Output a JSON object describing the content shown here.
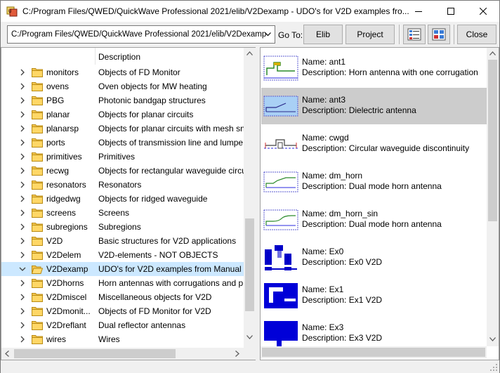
{
  "window": {
    "title": "C:/Program Files/QWED/QuickWave Professional 2021/elib/V2Dexamp - UDO's for V2D examples fro..."
  },
  "toolbar": {
    "path_value": "C:/Program Files/QWED/QuickWave Professional 2021/elib/V2Dexamp",
    "goto_label": "Go To:",
    "elib_label": "Elib",
    "project_label": "Project",
    "close_label": "Close"
  },
  "tree": {
    "header_description": "Description",
    "rows": [
      {
        "name": "monitors",
        "desc": "Objects of FD Monitor"
      },
      {
        "name": "ovens",
        "desc": "Oven objects for MW heating"
      },
      {
        "name": "PBG",
        "desc": "Photonic bandgap structures"
      },
      {
        "name": "planar",
        "desc": "Objects for planar circuits"
      },
      {
        "name": "planarsp",
        "desc": "Objects for planar circuits with mesh sn"
      },
      {
        "name": "ports",
        "desc": "Objects of transmission line and lumpe"
      },
      {
        "name": "primitives",
        "desc": "Primitives"
      },
      {
        "name": "recwg",
        "desc": "Objects for rectangular waveguide circu"
      },
      {
        "name": "resonators",
        "desc": "Resonators"
      },
      {
        "name": "ridgedwg",
        "desc": "Objects for ridged waveguide"
      },
      {
        "name": "screens",
        "desc": "Screens"
      },
      {
        "name": "subregions",
        "desc": "Subregions"
      },
      {
        "name": "V2D",
        "desc": "Basic structures for V2D applications"
      },
      {
        "name": "V2Delem",
        "desc": "V2D-elements - NOT OBJECTS"
      },
      {
        "name": "V2Dexamp",
        "desc": "UDO's for V2D examples from Manual"
      },
      {
        "name": "V2Dhorns",
        "desc": "Horn antennas with corrugations and p"
      },
      {
        "name": "V2Dmiscel",
        "desc": "Miscellaneous objects for V2D"
      },
      {
        "name": "V2Dmonit...",
        "desc": "Objects of FD Monitor for V2D"
      },
      {
        "name": "V2Dreflant",
        "desc": "Dual reflector antennas"
      },
      {
        "name": "wires",
        "desc": "Wires"
      }
    ]
  },
  "udo_list": {
    "items": [
      {
        "name": "Name: ant1",
        "desc": "Description: Horn antenna with one corrugation"
      },
      {
        "name": "Name: ant3",
        "desc": "Description: Dielectric antenna"
      },
      {
        "name": "Name: cwgd",
        "desc": "Description: Circular waveguide discontinuity"
      },
      {
        "name": "Name: dm_horn",
        "desc": "Description: Dual mode horn antenna"
      },
      {
        "name": "Name: dm_horn_sin",
        "desc": "Description: Dual mode horn antenna"
      },
      {
        "name": "Name: Ex0",
        "desc": "Description: Ex0 V2D"
      },
      {
        "name": "Name: Ex1",
        "desc": "Description: Ex1 V2D"
      },
      {
        "name": "Name: Ex3",
        "desc": "Description: Ex3 V2D"
      }
    ]
  },
  "colors": {
    "selection_tree": "#cce8ff",
    "selection_list": "#cccccc",
    "folder": "#e8b84a"
  }
}
